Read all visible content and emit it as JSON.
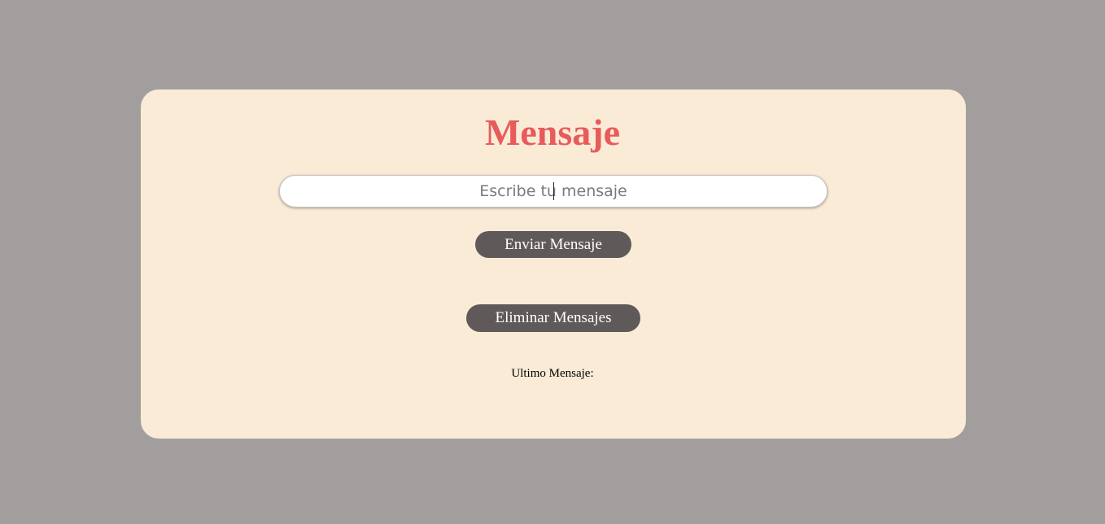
{
  "header": {
    "title": "Mensaje"
  },
  "form": {
    "input_placeholder": "Escribe tu mensaje",
    "input_value": "",
    "send_label": "Enviar Mensaje",
    "delete_label": "Eliminar Mensajes"
  },
  "output": {
    "last_message_label": "Ultimo Mensaje:"
  },
  "colors": {
    "background": "#a39e9e",
    "card": "#faebd7",
    "title": "#e85b5b",
    "button": "#5f5a59",
    "button_text": "#ffffff"
  }
}
